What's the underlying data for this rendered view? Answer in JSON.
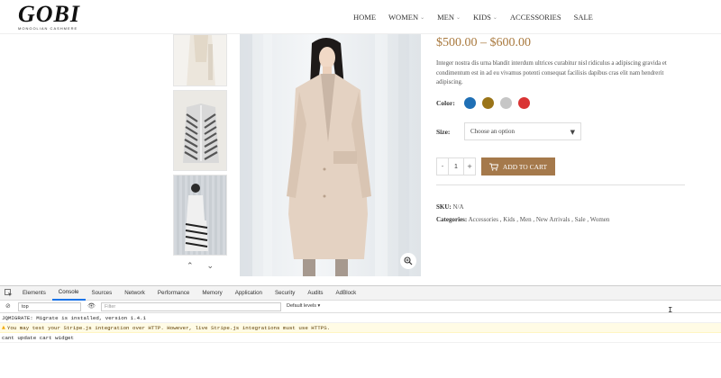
{
  "header": {
    "logo_main": "GOBI",
    "logo_sub": "MONGOLIAN CASHMERE",
    "nav": [
      {
        "label": "HOME",
        "caret": false
      },
      {
        "label": "WOMEN",
        "caret": true
      },
      {
        "label": "MEN",
        "caret": true
      },
      {
        "label": "KIDS",
        "caret": true
      },
      {
        "label": "ACCESSORIES",
        "caret": false
      },
      {
        "label": "SALE",
        "caret": false
      }
    ]
  },
  "product": {
    "price": "$500.00 – $600.00",
    "description": "Integer nostra dis urna blandit interdum ultrices curabitur nisl ridiculus a adipiscing gravida et condimentum est in ad eu vivamus potenti consequat facilisis dapibus cras elit nam hendrerit adipiscing.",
    "color_label": "Color:",
    "colors": [
      "#1f6fb5",
      "#9a7418",
      "#c6c6c6",
      "#d93434"
    ],
    "size_label": "Size:",
    "size_placeholder": "Choose an option",
    "quantity": "1",
    "qty_minus": "-",
    "qty_plus": "+",
    "add_to_cart": "ADD TO CART",
    "sku_label": "SKU:",
    "sku_value": "N/A",
    "categories_label": "Categories:",
    "categories": "Accessories , Kids , Men , New Arrivals , Sale , Women"
  },
  "gallery": {
    "prev": "^",
    "next": "v"
  },
  "devtools": {
    "tabs": [
      "Elements",
      "Console",
      "Sources",
      "Network",
      "Performance",
      "Memory",
      "Application",
      "Security",
      "Audits",
      "AdBlock"
    ],
    "active_tab": "Console",
    "context": "top",
    "filter_placeholder": "Filter",
    "levels": "Default levels ▾",
    "console_lines": [
      {
        "type": "log",
        "text": "JQMIGRATE: Migrate is installed, version 1.4.1"
      },
      {
        "type": "warn",
        "text": "You may test your Stripe.js integration over HTTP. However, live Stripe.js integrations must use HTTPS."
      },
      {
        "type": "log",
        "text": "cant update cart widget"
      }
    ]
  }
}
